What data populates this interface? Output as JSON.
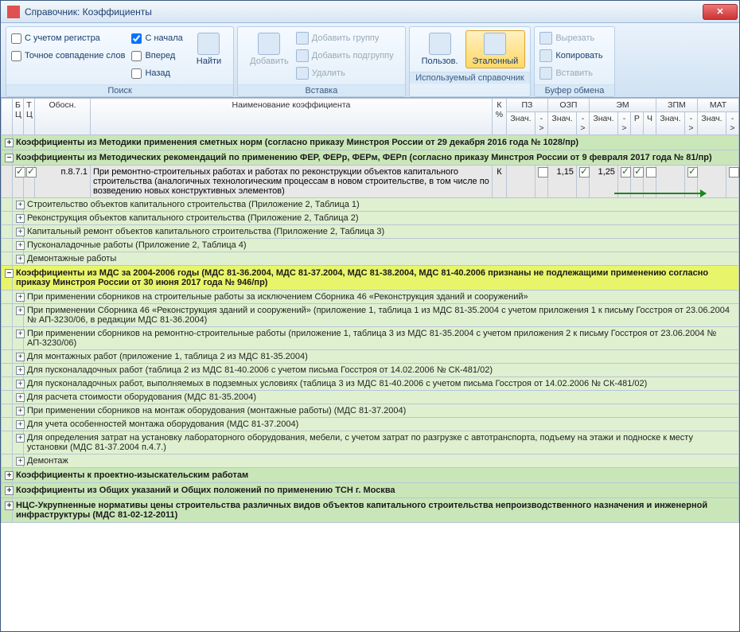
{
  "window": {
    "title": "Справочник: Коэффициенты"
  },
  "ribbon": {
    "search": {
      "register": "С учетом регистра",
      "exact": "Точное совпадение слов",
      "fromstart": "С начала",
      "forward": "Вперед",
      "back": "Назад",
      "find": "Найти",
      "label": "Поиск"
    },
    "insert": {
      "add": "Добавить",
      "addgroup": "Добавить группу",
      "addsubgroup": "Добавить подгруппу",
      "delete": "Удалить",
      "label": "Вставка"
    },
    "refbook": {
      "user": "Пользов.",
      "ref": "Эталонный",
      "label": "Используемый справочник"
    },
    "clipboard": {
      "cut": "Вырезать",
      "copy": "Копировать",
      "paste": "Вставить",
      "label": "Буфер обмена"
    }
  },
  "headers": {
    "b": "Б\nЦ",
    "t": "Т\nЦ",
    "obosn": "Обосн.",
    "name": "Наименование коэффициента",
    "kpct": "К\n%",
    "pz": "ПЗ",
    "ozp": "ОЗП",
    "em": "ЭМ",
    "zpm": "ЗПМ",
    "mat": "МАТ",
    "znach": "Знач.",
    "arrow": "->",
    "r": "Р",
    "ch": "Ч"
  },
  "row": {
    "obosn": "п.8.7.1",
    "name": "При ремонтно-строительных работах и работах по реконструкции объектов капитального строительства (аналогичных технологическим процессам в новом строительстве, в том числе по возведению новых конструктивных элементов)",
    "k": "К",
    "ozp": "1,15",
    "em": "1,25"
  },
  "groups": {
    "g1": "Коэффициенты из Методики применения сметных норм (согласно приказу Минстроя России от 29 декабря 2016 года № 1028/пр)",
    "g2": "Коэффициенты из Методических рекомендаций по применению ФЕР, ФЕРр, ФЕРм, ФЕРп (согласно приказу Минстроя России от 9 февраля 2017 года № 81/пр)",
    "s1": "Строительство объектов капитального строительства (Приложение 2, Таблица 1)",
    "s2": "Реконструкция объектов капитального строительства (Приложение 2, Таблица 2)",
    "s3": "Капитальный ремонт объектов капитального строительства (Приложение 2, Таблица 3)",
    "s4": "Пусконаладочные работы (Приложение 2, Таблица 4)",
    "s5": "Демонтажные работы",
    "g3": "Коэффициенты из МДС за 2004-2006 годы (МДС 81-36.2004, МДС 81-37.2004, МДС 81-38.2004, МДС 81-40.2006 признаны не подлежащими применению согласно приказу Минстроя России от 30 июня 2017 года № 946/пр)",
    "s6": "При применении сборников на строительные работы за исключением Сборника 46 «Реконструкция зданий и сооружений»",
    "s7": "При применении Сборника 46 «Реконструкция зданий и сооружений» (приложение 1, таблица 1 из МДС 81-35.2004 с учетом приложения 1 к письму Госстроя от 23.06.2004 № АП-3230/06, в редакции МДС 81-36.2004)",
    "s8": "При применении сборников на ремонтно-строительные работы (приложение 1, таблица 3 из МДС 81-35.2004 с учетом приложения 2 к письму Госстроя от 23.06.2004 № АП-3230/06)",
    "s9": "Для монтажных работ (приложение 1, таблица 2 из МДС 81-35.2004)",
    "s10": "Для пусконаладочных работ (таблица 2 из МДС 81-40.2006 с учетом письма Госстроя от 14.02.2006 № СК-481/02)",
    "s11": "Для пусконаладочных работ, выполняемых в подземных условиях (таблица 3 из МДС 81-40.2006 с учетом письма Госстроя от 14.02.2006 № СК-481/02)",
    "s12": "Для расчета стоимости оборудования (МДС 81-35.2004)",
    "s13": "При применении сборников на монтаж оборудования (монтажные работы) (МДС 81-37.2004)",
    "s14": "Для учета особенностей монтажа оборудования (МДС 81-37.2004)",
    "s15": "Для определения затрат на установку лабораторного оборудования, мебели, с учетом затрат по разгрузке с автотранспорта, подъему на этажи и подноске к месту установки (МДС 81-37.2004 п.4.7.)",
    "s16": "Демонтаж",
    "g4": "Коэффициенты к проектно-изыскательским работам",
    "g5": "Коэффициенты из Общих указаний и Общих положений по применению ТСН г. Москва",
    "g6": "НЦС-Укрупненные нормативы цены строительства различных видов объектов капитального строительства непроизводственного назначения и инженерной инфраструктуры (МДС 81-02-12-2011)"
  }
}
